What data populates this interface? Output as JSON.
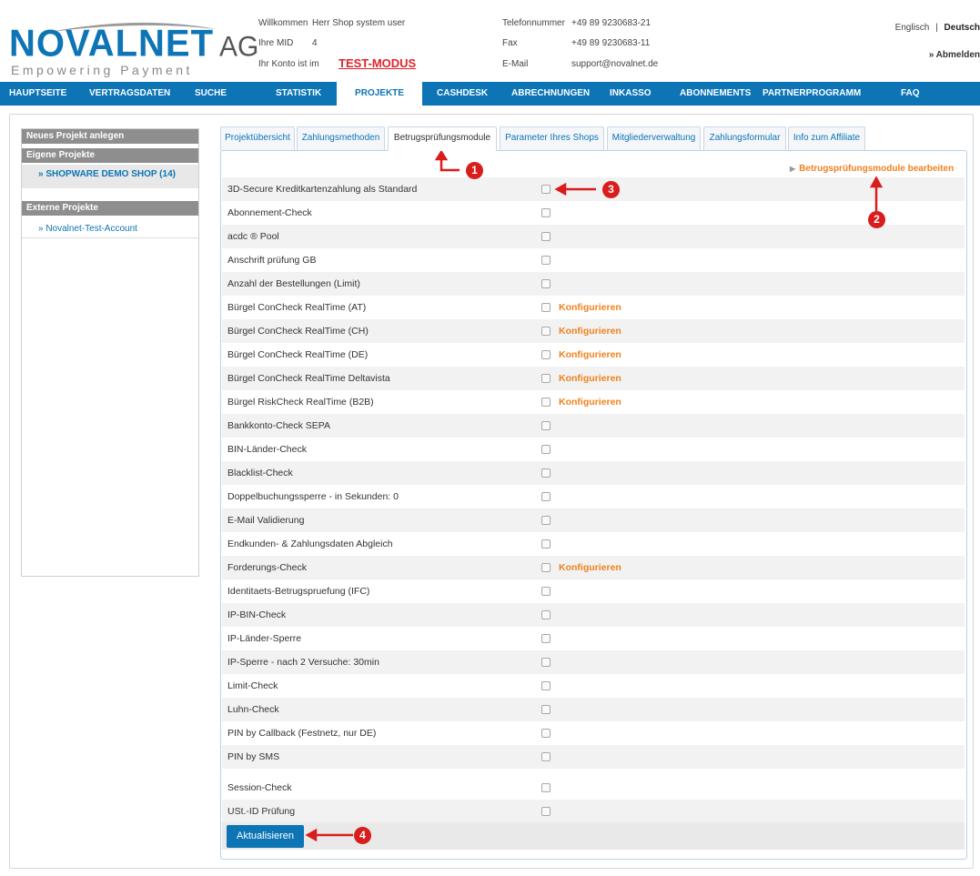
{
  "brand": {
    "name": "NOVALNET",
    "suffix": "AG",
    "tagline": "Empowering Payment"
  },
  "account": {
    "welcome_label": "Willkommen",
    "welcome_value": "Herr Shop system user",
    "mid_label": "Ihre MID",
    "mid_value": "4",
    "mode_label": "Ihr Konto ist im",
    "mode_value": "TEST-MODUS"
  },
  "contact": {
    "phone_label": "Telefonnummer",
    "phone_value": "+49 89 9230683-21",
    "fax_label": "Fax",
    "fax_value": "+49 89 9230683-11",
    "email_label": "E-Mail",
    "email_value": "support@novalnet.de"
  },
  "language": {
    "english": "Englisch",
    "separator": "|",
    "german": "Deutsch"
  },
  "logout_label": "» Abmelden",
  "nav": [
    "HAUPTSEITE",
    "VERTRAGSDATEN",
    "SUCHE",
    "STATISTIK",
    "PROJEKTE",
    "CASHDESK",
    "ABRECHNUNGEN",
    "INKASSO",
    "ABONNEMENTS",
    "PARTNERPROGRAMM",
    "FAQ"
  ],
  "nav_active": "PROJEKTE",
  "sidebar": {
    "new_project": "Neues Projekt anlegen",
    "own_projects": "Eigene Projekte",
    "own_item": "» SHOPWARE DEMO SHOP (14)",
    "external_projects": "Externe Projekte",
    "external_item": "» Novalnet-Test-Account"
  },
  "tabs": [
    "Projektübersicht",
    "Zahlungsmethoden",
    "Betrugsprüfungsmodule",
    "Parameter Ihres Shops",
    "Mitgliederverwaltung",
    "Zahlungsformular",
    "Info zum Affiliate"
  ],
  "tab_active": "Betrugsprüfungsmodule",
  "edit_link": "Betrugsprüfungsmodule bearbeiten",
  "configure_label": "Konfigurieren",
  "modules": [
    {
      "label": "3D-Secure Kreditkartenzahlung als Standard",
      "checked": false,
      "configurable": false
    },
    {
      "label": "Abonnement-Check",
      "checked": false,
      "configurable": false
    },
    {
      "label": "acdc ® Pool",
      "checked": false,
      "configurable": false
    },
    {
      "label": "Anschrift prüfung GB",
      "checked": false,
      "configurable": false
    },
    {
      "label": "Anzahl der Bestellungen (Limit)",
      "checked": false,
      "configurable": false
    },
    {
      "label": "Bürgel ConCheck RealTime (AT)",
      "checked": false,
      "configurable": true
    },
    {
      "label": "Bürgel ConCheck RealTime (CH)",
      "checked": false,
      "configurable": true
    },
    {
      "label": "Bürgel ConCheck RealTime (DE)",
      "checked": false,
      "configurable": true
    },
    {
      "label": "Bürgel ConCheck RealTime Deltavista",
      "checked": false,
      "configurable": true
    },
    {
      "label": "Bürgel RiskCheck RealTime (B2B)",
      "checked": false,
      "configurable": true
    },
    {
      "label": "Bankkonto-Check SEPA",
      "checked": false,
      "configurable": false
    },
    {
      "label": "BIN-Länder-Check",
      "checked": false,
      "configurable": false
    },
    {
      "label": "Blacklist-Check",
      "checked": false,
      "configurable": false
    },
    {
      "label": "Doppelbuchungssperre - in Sekunden: 0",
      "checked": false,
      "configurable": false
    },
    {
      "label": "E-Mail Validierung",
      "checked": false,
      "configurable": false
    },
    {
      "label": "Endkunden- & Zahlungsdaten Abgleich",
      "checked": false,
      "configurable": false
    },
    {
      "label": "Forderungs-Check",
      "checked": false,
      "configurable": true
    },
    {
      "label": "Identitaets-Betrugspruefung (IFC)",
      "checked": false,
      "configurable": false
    },
    {
      "label": "IP-BIN-Check",
      "checked": false,
      "configurable": false
    },
    {
      "label": "IP-Länder-Sperre",
      "checked": false,
      "configurable": false
    },
    {
      "label": "IP-Sperre - nach 2 Versuche: 30min",
      "checked": false,
      "configurable": false
    },
    {
      "label": "Limit-Check",
      "checked": false,
      "configurable": false
    },
    {
      "label": "Luhn-Check",
      "checked": false,
      "configurable": false
    },
    {
      "label": "PIN by Callback (Festnetz, nur DE)",
      "checked": false,
      "configurable": false
    },
    {
      "label": "PIN by SMS",
      "checked": false,
      "configurable": false
    },
    {
      "label": "Session-Check",
      "checked": false,
      "configurable": false
    },
    {
      "label": "USt.-ID Prüfung",
      "checked": false,
      "configurable": false
    }
  ],
  "update_button": "Aktualisieren",
  "markers": [
    "1",
    "2",
    "3",
    "4"
  ],
  "colors": {
    "brand_blue": "#0d75b5",
    "accent_orange": "#f0821e",
    "test_red": "#e0232b",
    "marker_red": "#d91c1c"
  }
}
